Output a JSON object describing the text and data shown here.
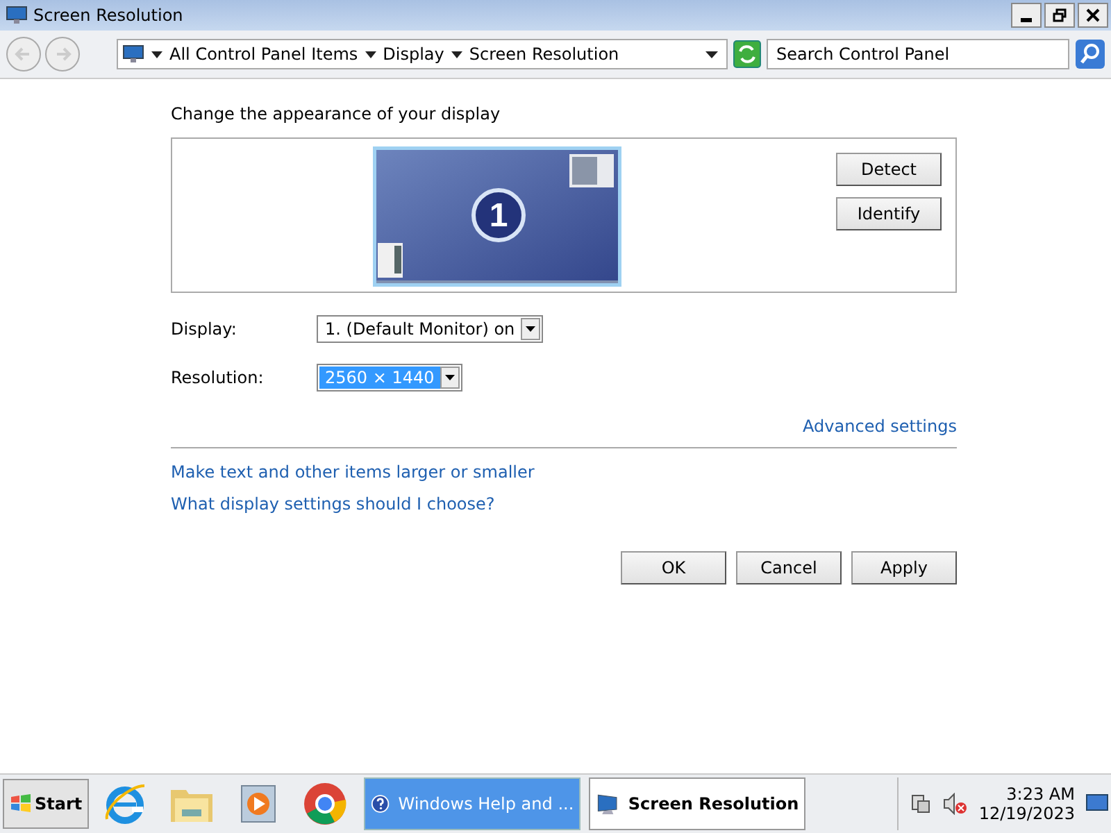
{
  "window": {
    "title": "Screen Resolution"
  },
  "address_bar": {
    "breadcrumbs": [
      "All Control Panel Items",
      "Display",
      "Screen Resolution"
    ]
  },
  "search": {
    "placeholder": "Search Control Panel"
  },
  "heading": "Change the appearance of your display",
  "monitor_preview": {
    "number": "1"
  },
  "preview_buttons": [
    "Detect",
    "Identify"
  ],
  "fields": [
    {
      "label": "Display:",
      "value": "1. (Default Monitor) on",
      "selected": false
    },
    {
      "label": "Resolution:",
      "value": "2560 × 1440",
      "selected": true
    }
  ],
  "advanced_link": "Advanced settings",
  "links": [
    "Make text and other items larger or smaller",
    "What display settings should I choose?"
  ],
  "buttons": [
    "OK",
    "Cancel",
    "Apply"
  ],
  "taskbar": {
    "start": "Start",
    "pinned": [
      {
        "kind": "browser-e"
      },
      {
        "kind": "folder"
      },
      {
        "kind": "player"
      },
      {
        "kind": "chrome"
      }
    ],
    "tasks": [
      {
        "label": "Windows Help and ...",
        "kind": "help",
        "selected": false
      },
      {
        "label": "Screen Resolution",
        "kind": "monitor",
        "selected": true
      }
    ],
    "time": "3:23 AM",
    "date": "12/19/2023"
  }
}
